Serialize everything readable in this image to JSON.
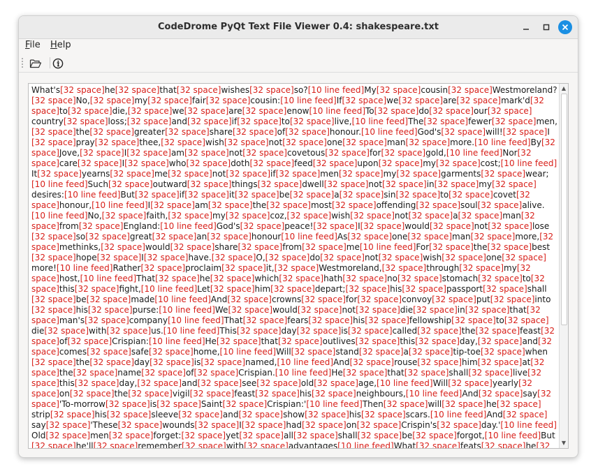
{
  "window": {
    "title": "CodeDrome PyQt Text File Viewer 0.4: shakespeare.txt"
  },
  "menu": {
    "file": {
      "u": "F",
      "rest": "ile"
    },
    "help": {
      "u": "H",
      "rest": "elp"
    }
  },
  "toolbar": {
    "open_icon": "folder-open-icon",
    "info_icon": "info-icon"
  },
  "markers": {
    "space": "[32 space]",
    "newline": "[10 line feed]"
  },
  "text": "What's he that wishes so?\nMy cousin Westmoreland? No, my fair cousin:\nIf we are mark'd to die, we are enow\nTo do our country loss; and if to live,\nThe fewer men, the greater share of honour.\nGod's will! I pray thee, wish not one man more.\nBy Jove, I am not covetous for gold,\nNor care I who doth feed upon my cost;\nIt yearns me not if men my garments wear;\nSuch outward things dwell not in my desires:\nBut if it be a sin to covet honour,\nI am the most offending soul alive.\nNo, faith, my coz, wish not a man from England:\nGod's peace! I would not lose so great an honour\nAs one man more, methinks, would share from me\nFor the best hope I have. O, do not wish one more!\nRather proclaim it, Westmoreland, through my host,\nThat he which hath no stomach to this fight,\nLet him depart; his passport shall be made\nAnd crowns for convoy put into his purse:\nWe would not die in that man's company\nThat fears his fellowship to die with us.\nThis day is called the feast of Crispian:\nHe that outlives this day, and comes safe home,\nWill stand a tip-toe when the day is named,\nAnd rouse him at the name of Crispian.\nHe that shall live this day, and see old age,\nWill yearly on the vigil feast his neighbours,\nAnd say 'To-morrow is Saint Crispian:'\nThen will he strip his sleeve and show his scars.\nAnd say 'These wounds I had on Crispin's day.'\nOld men forget: yet all shall be forgot,\nBut he'll remember with advantages\nWhat feats he did that day: then shall our names,"
}
